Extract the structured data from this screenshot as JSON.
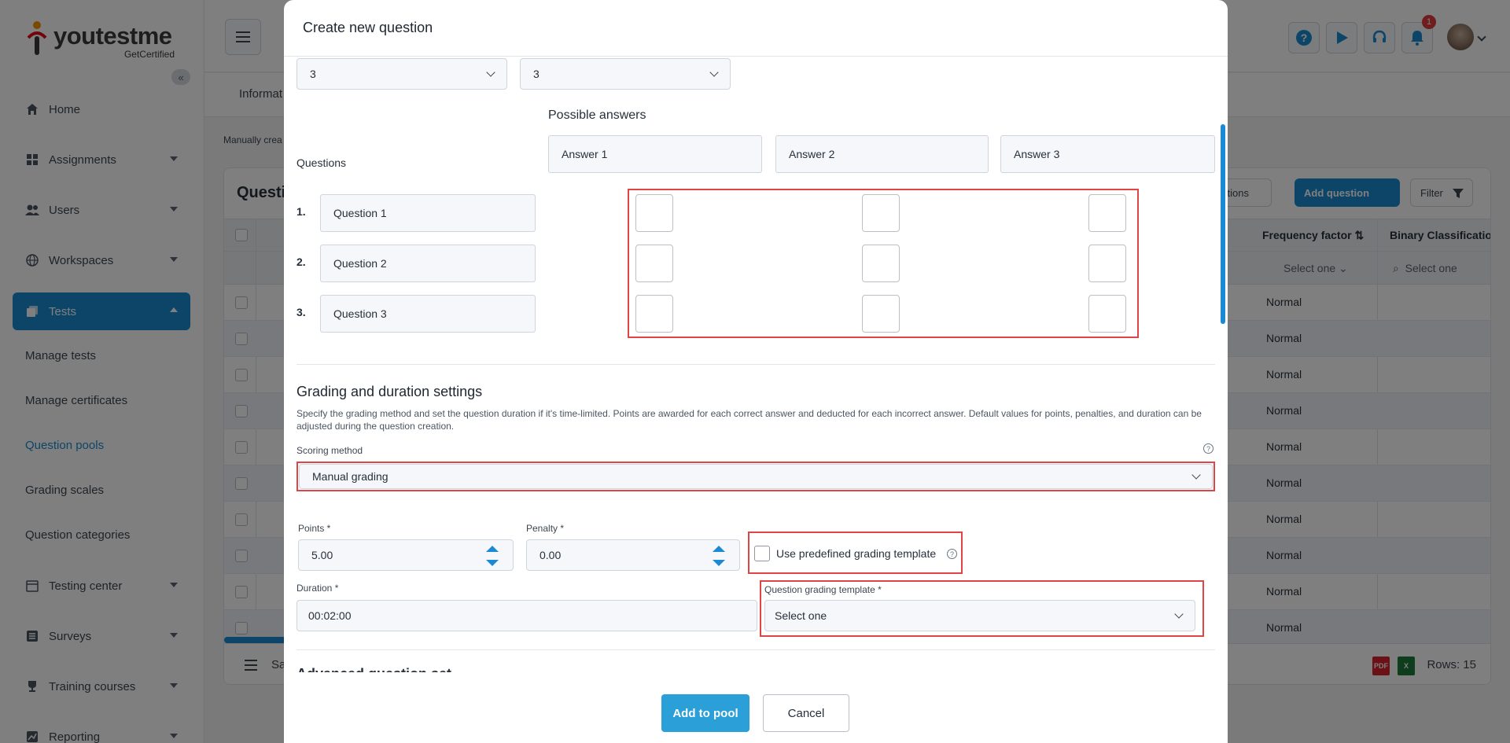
{
  "app": {
    "logo_text": "youtestme",
    "logo_sub": "GetCertified",
    "sidebar": {
      "items": [
        {
          "label": "Home",
          "icon": "home-icon"
        },
        {
          "label": "Assignments",
          "icon": "assignments-icon"
        },
        {
          "label": "Users",
          "icon": "users-icon"
        },
        {
          "label": "Workspaces",
          "icon": "globe-icon"
        },
        {
          "label": "Tests",
          "icon": "tests-icon"
        },
        {
          "label": "Testing center",
          "icon": "calendar-icon"
        },
        {
          "label": "Surveys",
          "icon": "list-icon"
        },
        {
          "label": "Training courses",
          "icon": "trophy-icon"
        },
        {
          "label": "Reporting",
          "icon": "report-icon"
        }
      ],
      "tests_subitems": [
        "Manage tests",
        "Manage certificates",
        "Question pools",
        "Grading scales",
        "Question categories"
      ],
      "current_subitem": "Question pools"
    },
    "topbar": {
      "notification_count": "1"
    },
    "background": {
      "tab_label": "Informat",
      "note": "Manually crea",
      "card_title": "Questi",
      "btn_questions": "stions",
      "btn_add_question": "Add question",
      "btn_filter": "Filter",
      "col_frequency": "Frequency factor",
      "col_binary": "Binary Classificatior",
      "select_one": "Select one",
      "row_value": "Normal",
      "rows_label": "Rows: 15",
      "footer_left": "Sa"
    }
  },
  "modal": {
    "title": "Create new question",
    "dropdown_left": "3",
    "dropdown_right": "3",
    "possible_answers_label": "Possible answers",
    "questions_label": "Questions",
    "answers": [
      "Answer 1",
      "Answer 2",
      "Answer 3"
    ],
    "questions": [
      {
        "num": "1.",
        "text": "Question 1"
      },
      {
        "num": "2.",
        "text": "Question 2"
      },
      {
        "num": "3.",
        "text": "Question 3"
      }
    ],
    "grading": {
      "title": "Grading and duration settings",
      "description": "Specify the grading method and set the question duration if it's time-limited. Points are awarded for each correct answer and deducted for each incorrect answer. Default values for points, penalties, and duration can be adjusted during the question creation.",
      "scoring_label": "Scoring method",
      "scoring_value": "Manual grading",
      "points_label": "Points *",
      "points_value": "5.00",
      "penalty_label": "Penalty *",
      "penalty_value": "0.00",
      "template_checkbox_label": "Use predefined grading template",
      "duration_label": "Duration *",
      "duration_value": "00:02:00",
      "template_label": "Question grading template *",
      "template_value": "Select one",
      "next_section_partial": "Advanced question set"
    },
    "footer": {
      "add_button": "Add to pool",
      "cancel_button": "Cancel"
    }
  },
  "colors": {
    "accent": "#1b8ad2",
    "primary_button": "#2a9fd8",
    "highlight_frame": "#e04444"
  }
}
